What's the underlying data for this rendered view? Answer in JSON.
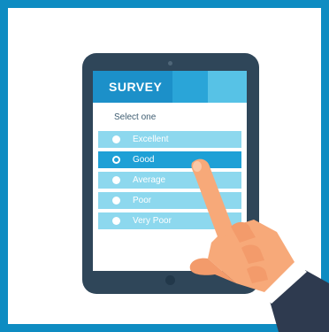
{
  "survey": {
    "title": "SURVEY",
    "prompt": "Select one",
    "options": [
      {
        "label": "Excellent",
        "selected": false
      },
      {
        "label": "Good",
        "selected": true
      },
      {
        "label": "Average",
        "selected": false
      },
      {
        "label": "Poor",
        "selected": false
      },
      {
        "label": "Very Poor",
        "selected": false
      }
    ]
  },
  "colors": {
    "background": "#0E8CC2",
    "tablet": "#2F4659",
    "header": "#1C90C9",
    "option": "#8DD8EE",
    "option_selected": "#1EA0D6",
    "skin": "#F7A979",
    "sleeve": "#2E3A4F"
  },
  "icons": [
    "radio-button-icon",
    "pointing-hand-icon"
  ]
}
